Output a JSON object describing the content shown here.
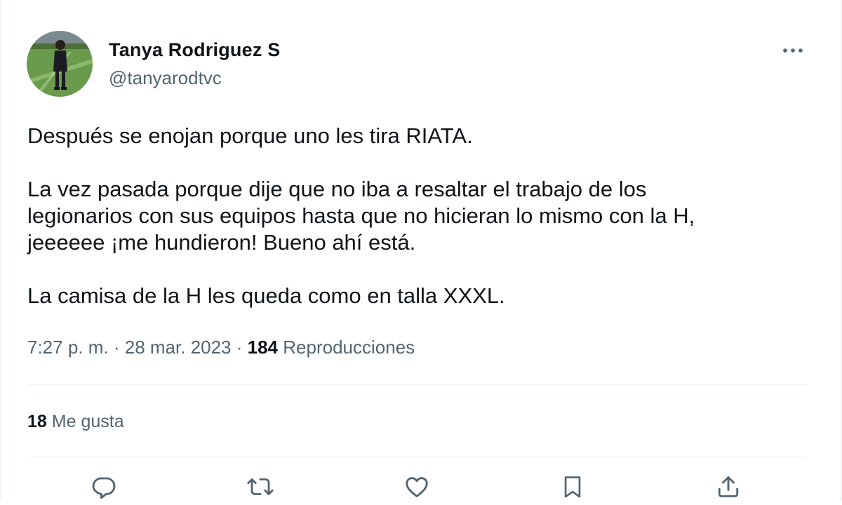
{
  "tweet": {
    "author": {
      "display_name": "Tanya Rodriguez S",
      "handle": "@tanyarodtvc",
      "avatar_icon": "person-on-soccer-field-avatar"
    },
    "more_icon": "ellipsis-icon",
    "text": {
      "p1": "Después se enojan porque uno les tira RIATA.",
      "p2_l1": "La vez pasada porque dije que no iba a resaltar el trabajo de los",
      "p2_l2": "legionarios con sus equipos hasta que no hicieran lo mismo con la H,",
      "p2_l3": "jeeeeee ¡me hundieron! Bueno ahí está.",
      "p3": "La camisa de la H les queda como en talla XXXL."
    },
    "meta": {
      "time": "7:27 p. m.",
      "separator": " · ",
      "date": "28 mar. 2023",
      "views_count": "184",
      "views_label": "Reproducciones"
    },
    "likes": {
      "count": "18",
      "label": "Me gusta"
    },
    "actions": [
      {
        "name": "reply",
        "icon": "reply-icon"
      },
      {
        "name": "retweet",
        "icon": "retweet-icon"
      },
      {
        "name": "like",
        "icon": "heart-icon"
      },
      {
        "name": "bookmark",
        "icon": "bookmark-icon"
      },
      {
        "name": "share",
        "icon": "share-icon"
      }
    ],
    "colors": {
      "text_primary": "#0f1419",
      "text_secondary": "#536471",
      "border": "#eff3f4"
    }
  }
}
